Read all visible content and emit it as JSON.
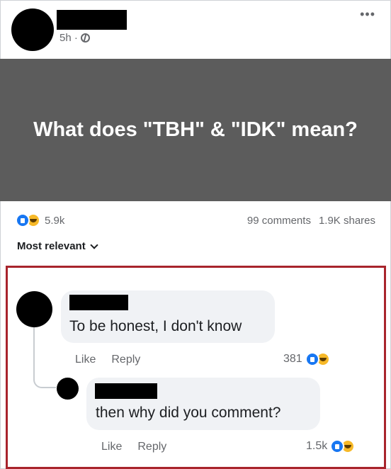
{
  "post": {
    "time": "5h ·",
    "more_label": "•••",
    "text": "What does \"TBH\" & \"IDK\" mean?"
  },
  "stats": {
    "reactions_count": "5.9k",
    "comments": "99 comments",
    "shares": "1.9K shares"
  },
  "sort_label": "Most relevant",
  "comments": [
    {
      "text": "To be honest, I don't know",
      "like_label": "Like",
      "reply_label": "Reply",
      "reactions_count": "381"
    },
    {
      "text": "then why did you comment?",
      "like_label": "Like",
      "reply_label": "Reply",
      "reactions_count": "1.5k"
    }
  ],
  "colors": {
    "post_background": "#5c5c5c",
    "highlight_border": "#a8242c",
    "like_blue": "#1877f2",
    "haha_yellow": "#f7b928"
  }
}
